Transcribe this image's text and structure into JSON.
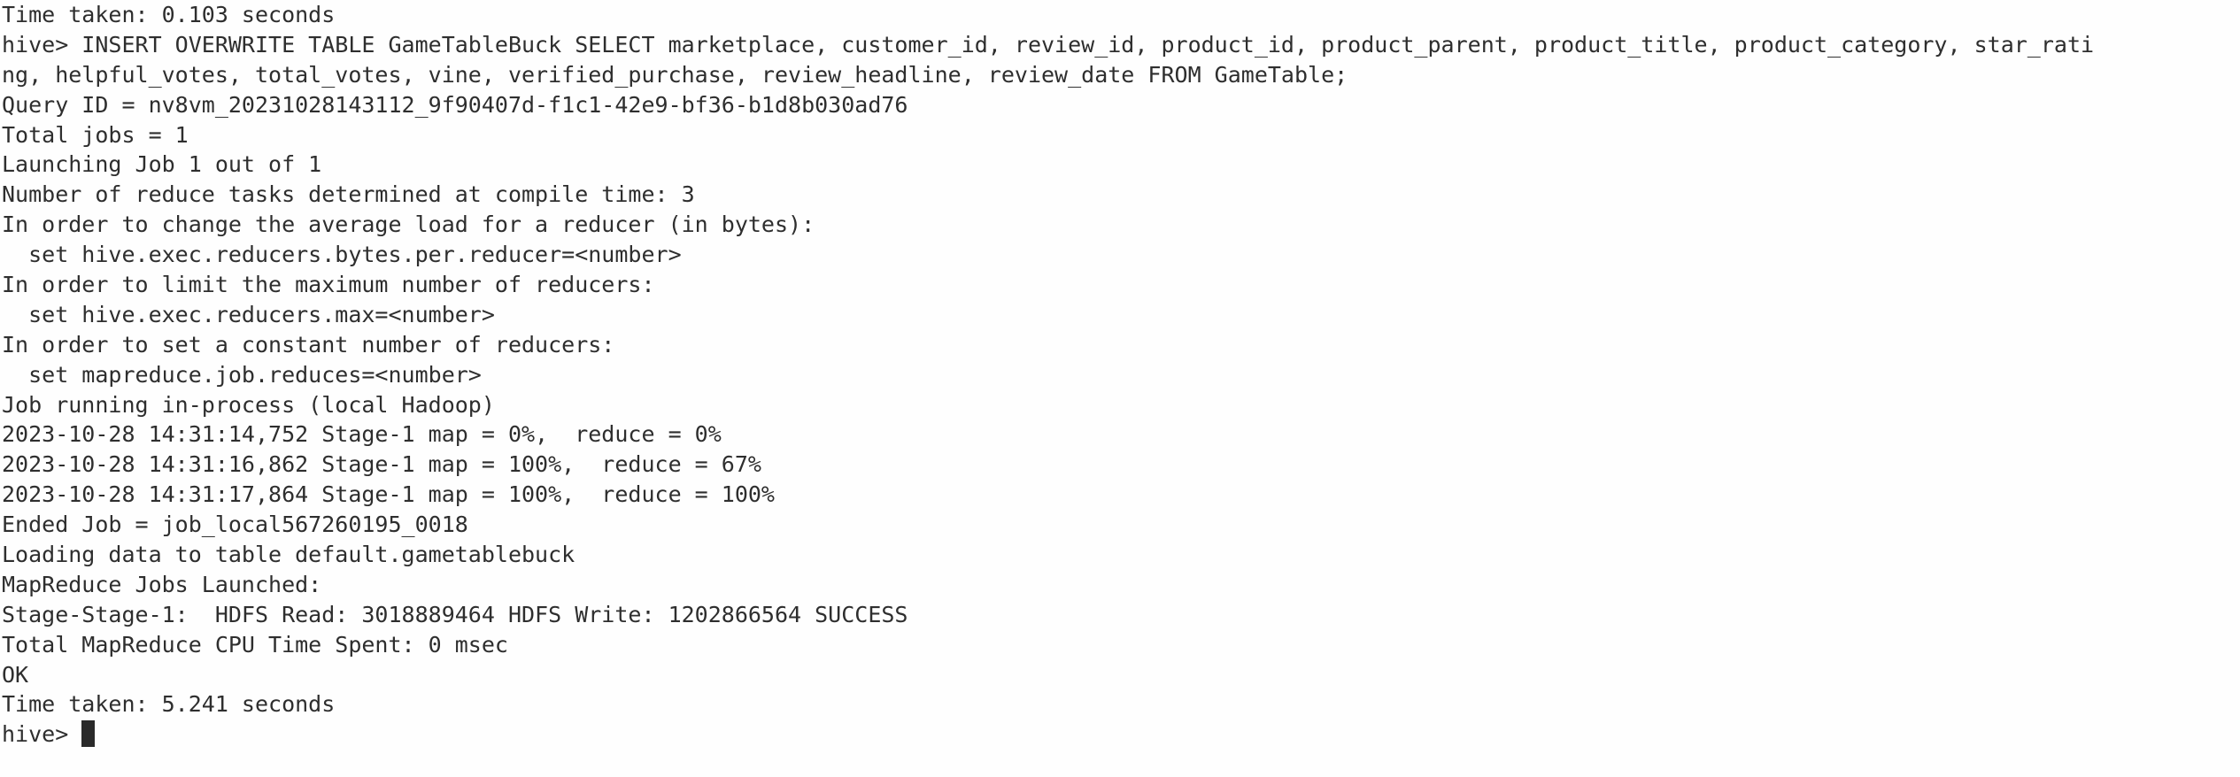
{
  "terminal": {
    "lines": [
      "Time taken: 0.103 seconds",
      "hive> INSERT OVERWRITE TABLE GameTableBuck SELECT marketplace, customer_id, review_id, product_id, product_parent, product_title, product_category, star_rati",
      "ng, helpful_votes, total_votes, vine, verified_purchase, review_headline, review_date FROM GameTable;",
      "Query ID = nv8vm_20231028143112_9f90407d-f1c1-42e9-bf36-b1d8b030ad76",
      "Total jobs = 1",
      "Launching Job 1 out of 1",
      "Number of reduce tasks determined at compile time: 3",
      "In order to change the average load for a reducer (in bytes):",
      "  set hive.exec.reducers.bytes.per.reducer=<number>",
      "In order to limit the maximum number of reducers:",
      "  set hive.exec.reducers.max=<number>",
      "In order to set a constant number of reducers:",
      "  set mapreduce.job.reduces=<number>",
      "Job running in-process (local Hadoop)",
      "2023-10-28 14:31:14,752 Stage-1 map = 0%,  reduce = 0%",
      "2023-10-28 14:31:16,862 Stage-1 map = 100%,  reduce = 67%",
      "2023-10-28 14:31:17,864 Stage-1 map = 100%,  reduce = 100%",
      "Ended Job = job_local567260195_0018",
      "Loading data to table default.gametablebuck",
      "MapReduce Jobs Launched:",
      "Stage-Stage-1:  HDFS Read: 3018889464 HDFS Write: 1202866564 SUCCESS",
      "Total MapReduce CPU Time Spent: 0 msec",
      "OK",
      "Time taken: 5.241 seconds"
    ],
    "prompt": "hive> "
  }
}
